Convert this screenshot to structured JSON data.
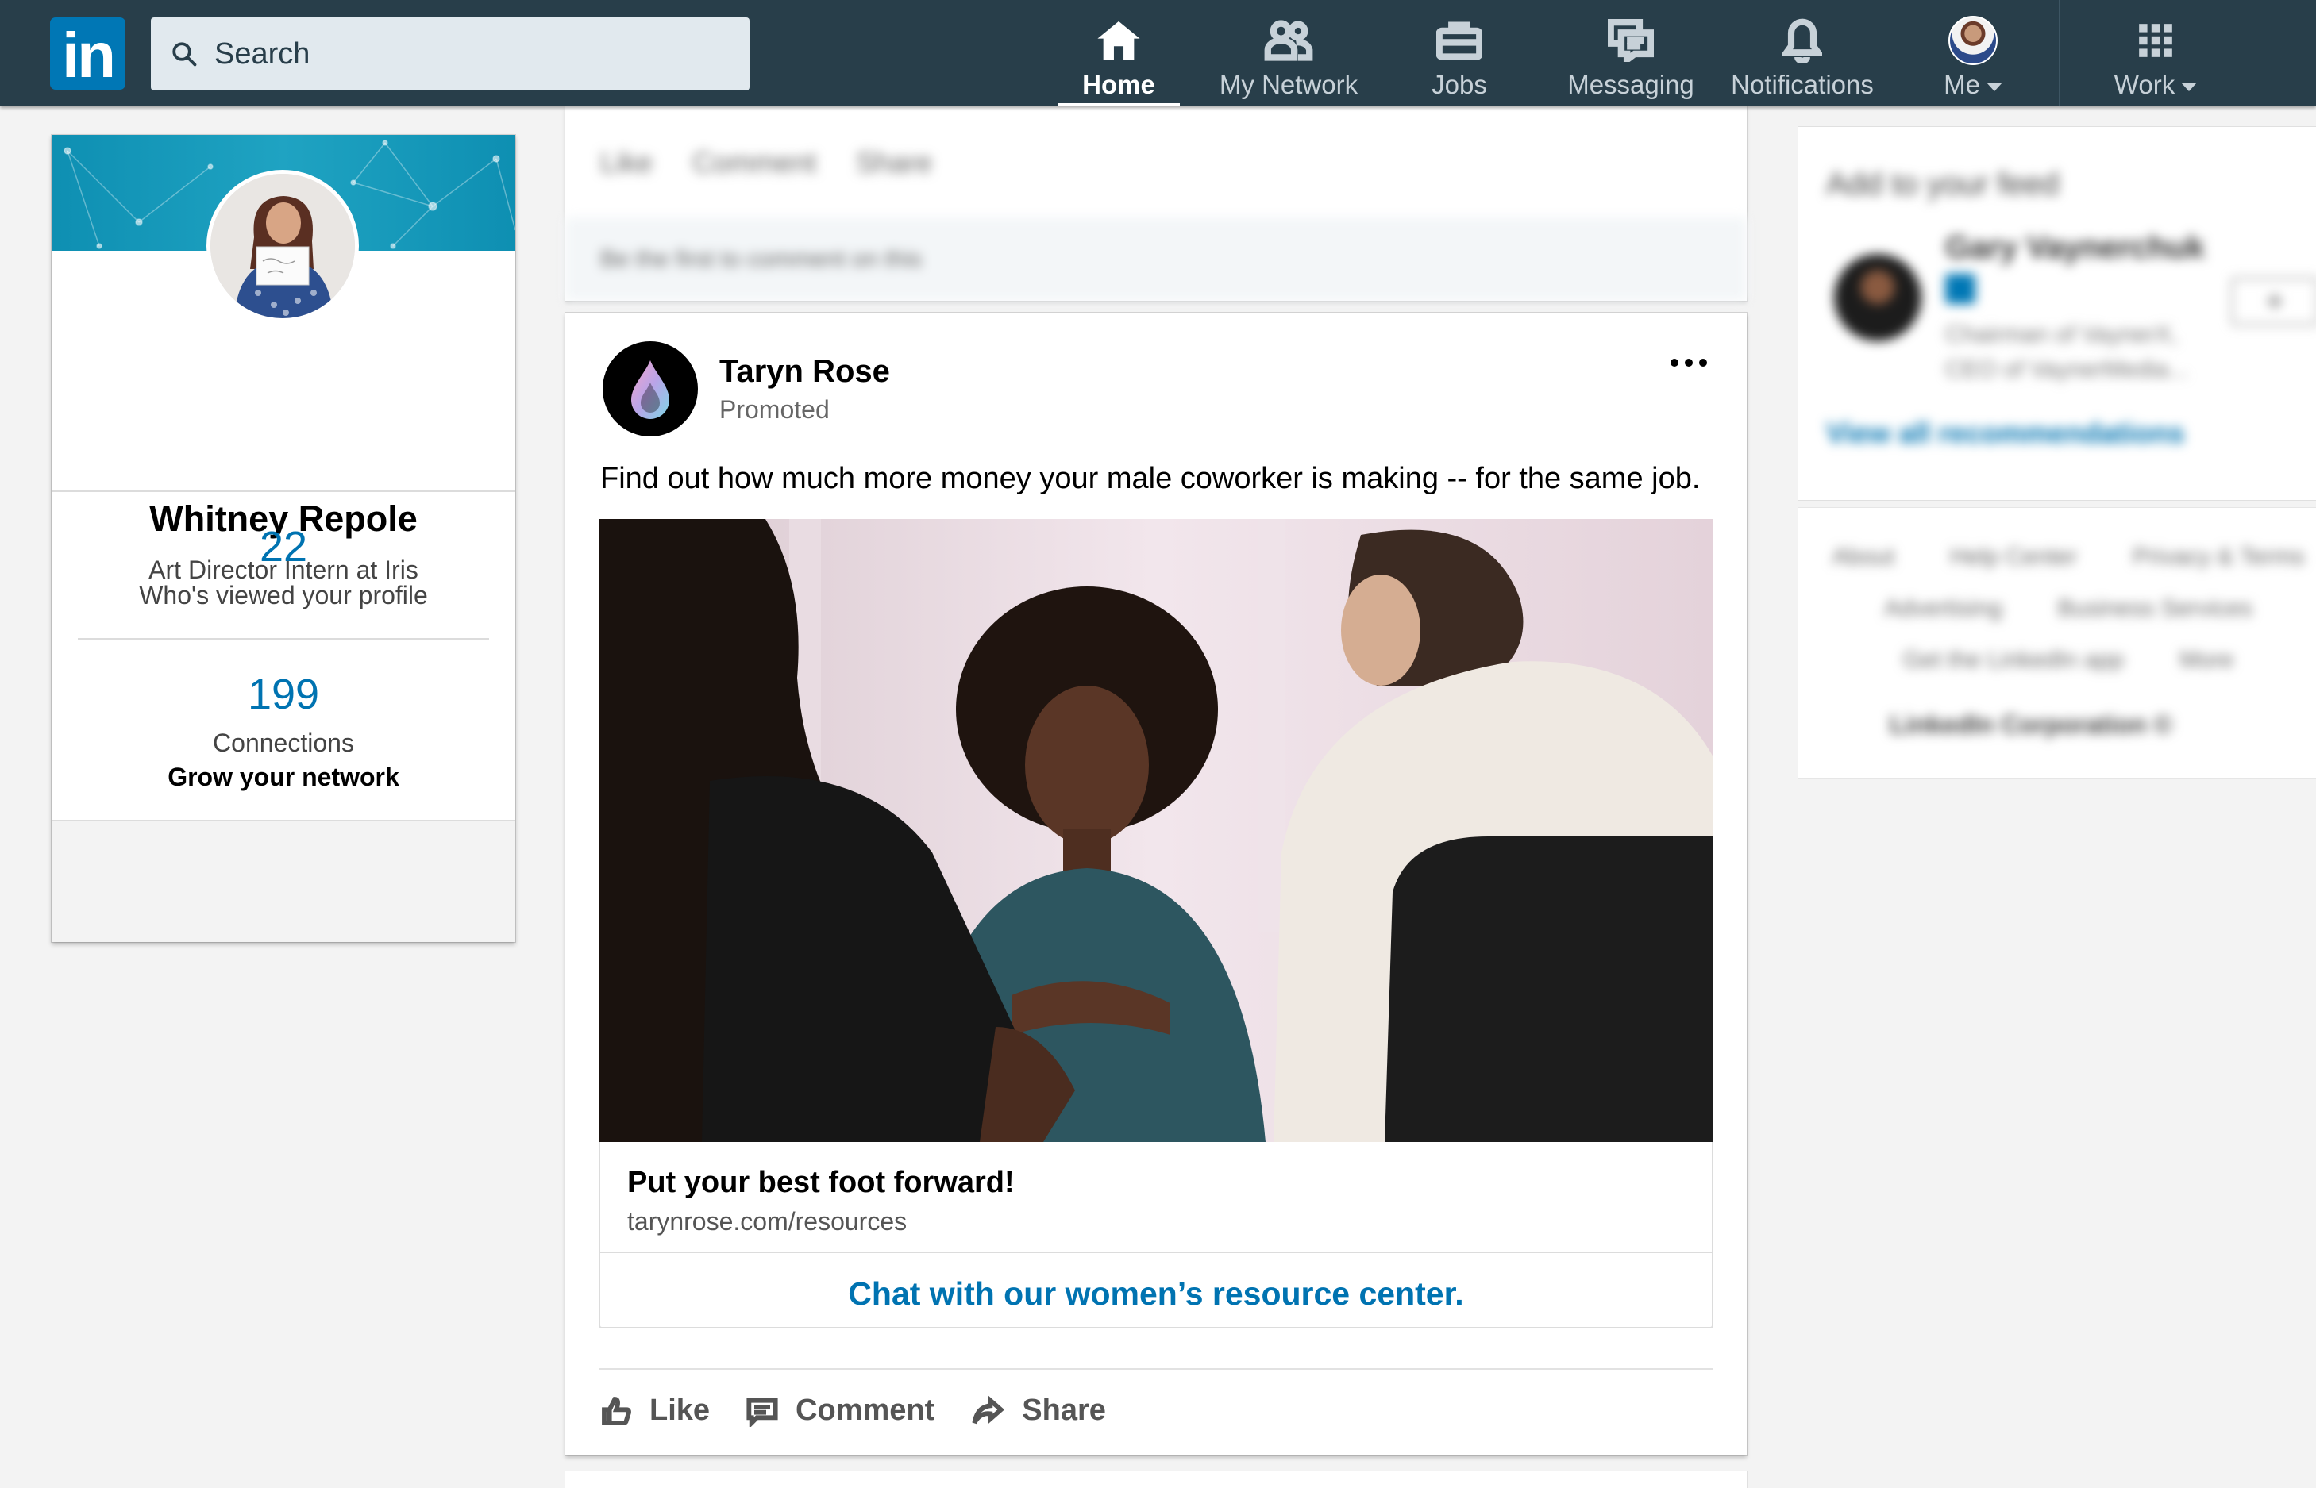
{
  "nav": {
    "search_placeholder": "Search",
    "items": [
      {
        "label": "Home",
        "icon": "home-icon"
      },
      {
        "label": "My Network",
        "icon": "people-icon"
      },
      {
        "label": "Jobs",
        "icon": "briefcase-icon"
      },
      {
        "label": "Messaging",
        "icon": "chat-icon"
      },
      {
        "label": "Notifications",
        "icon": "bell-icon"
      },
      {
        "label": "Me",
        "icon": "avatar"
      },
      {
        "label": "Work",
        "icon": "grid-icon"
      }
    ],
    "logo": "in"
  },
  "profile": {
    "name": "Whitney Repole",
    "headline": "Art Director Intern at Iris",
    "views_count": "22",
    "views_label": "Who's viewed your profile",
    "connections_count": "199",
    "connections_label": "Connections",
    "grow_label": "Grow your network"
  },
  "top_post": {
    "actions": [
      "Like",
      "Comment",
      "Share"
    ],
    "comment_prompt": "Be the first to comment on this"
  },
  "ad_post": {
    "author": "Taryn Rose",
    "promoted": "Promoted",
    "text": "Find out how much more money your male coworker is making -- for the same job.",
    "headline": "Put your best foot forward!",
    "url": "tarynrose.com/resources",
    "cta": "Chat with our women’s resource center.",
    "actions": {
      "like": "Like",
      "comment": "Comment",
      "share": "Share"
    }
  },
  "right_rail": {
    "title": "Add to your feed",
    "rec_name": "Gary Vaynerchuk",
    "rec_desc_1": "Chairman of VaynerX,",
    "rec_desc_2": "CEO of VaynerMedia...",
    "follow": "+",
    "view_all": "View all recommendations",
    "footer_row1": [
      "About",
      "Help Center",
      "Privacy & Terms"
    ],
    "footer_row2": [
      "Advertising",
      "Business Services"
    ],
    "footer_row3": [
      "Get the LinkedIn app",
      "More"
    ],
    "brand": "LinkedIn Corporation ©"
  },
  "colors": {
    "nav_bg": "#283e4a",
    "brand_blue": "#0077b5",
    "link_blue": "#0073b1"
  }
}
